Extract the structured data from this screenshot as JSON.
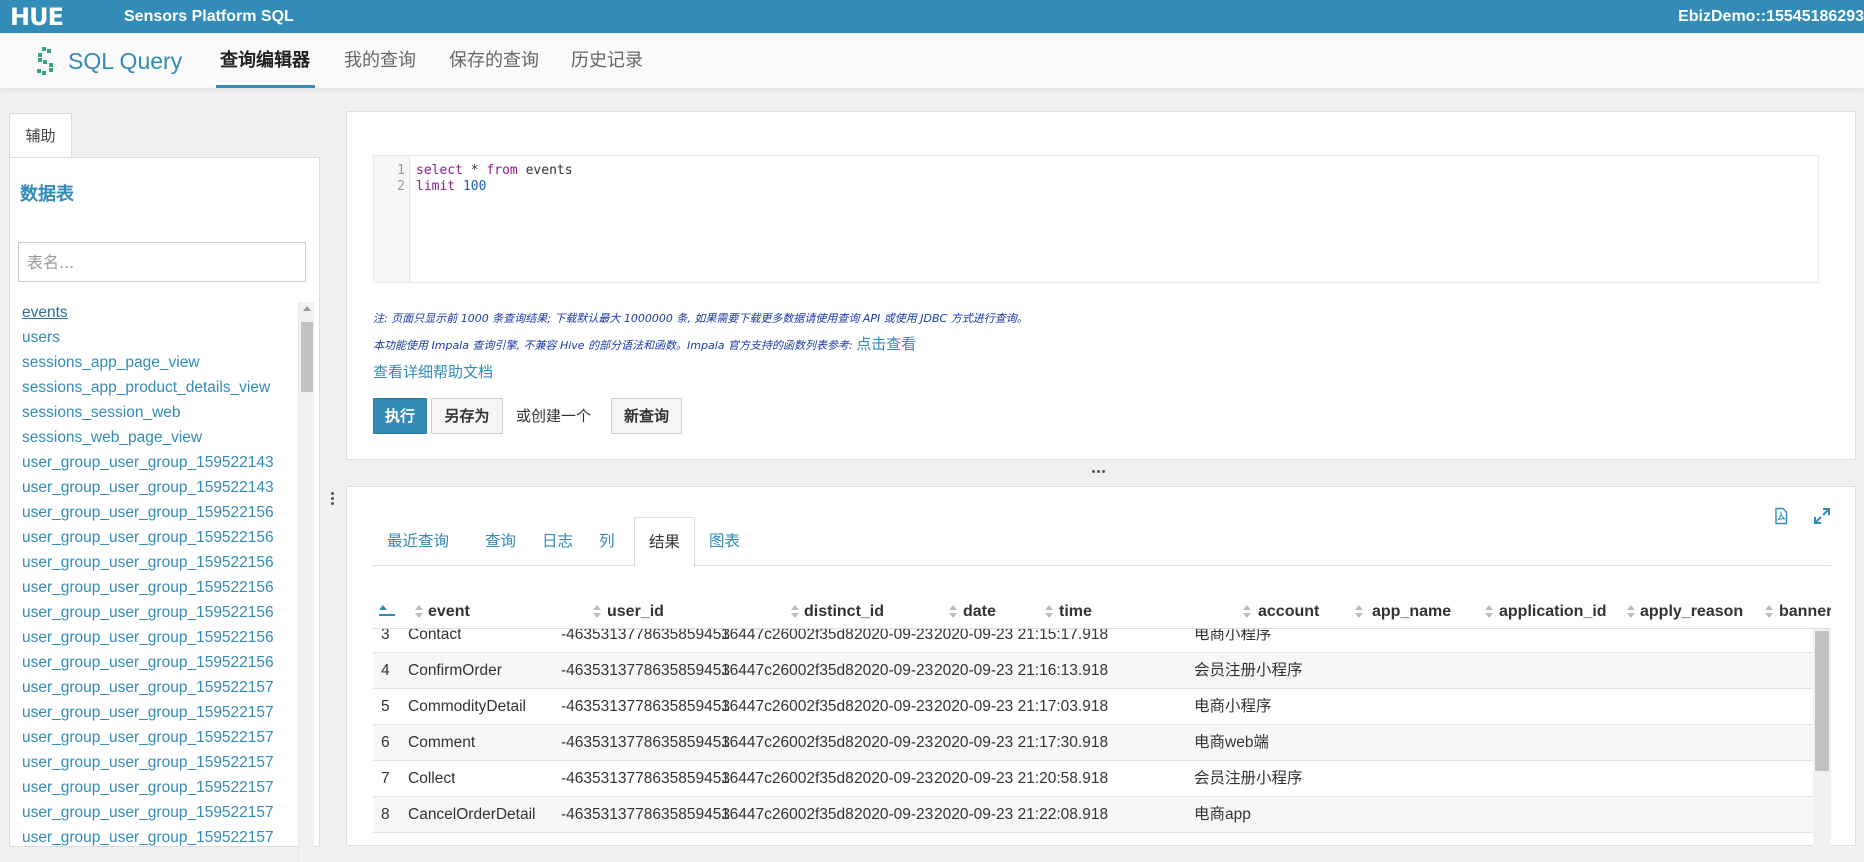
{
  "topbar": {
    "logo": "HUE",
    "platform_title": "Sensors Platform SQL",
    "user": "EbizDemo::15545186293"
  },
  "nav": {
    "app_title": "SQL Query",
    "tabs": [
      {
        "label": "查询编辑器",
        "active": true
      },
      {
        "label": "我的查询",
        "active": false
      },
      {
        "label": "保存的查询",
        "active": false
      },
      {
        "label": "历史记录",
        "active": false
      }
    ]
  },
  "assist": {
    "tab_label": "辅助",
    "heading": "数据表",
    "search_placeholder": "表名...",
    "tables": [
      "events",
      "users",
      "sessions_app_page_view",
      "sessions_app_product_details_view",
      "sessions_session_web",
      "sessions_web_page_view",
      "user_group_user_group_159522143",
      "user_group_user_group_159522143",
      "user_group_user_group_159522156",
      "user_group_user_group_159522156",
      "user_group_user_group_159522156",
      "user_group_user_group_159522156",
      "user_group_user_group_159522156",
      "user_group_user_group_159522156",
      "user_group_user_group_159522156",
      "user_group_user_group_159522157",
      "user_group_user_group_159522157",
      "user_group_user_group_159522157",
      "user_group_user_group_159522157",
      "user_group_user_group_159522157",
      "user_group_user_group_159522157",
      "user_group_user_group_159522157"
    ]
  },
  "editor": {
    "lines": [
      {
        "num": "1",
        "tokens": [
          [
            "kw",
            "select"
          ],
          [
            "txt",
            " * "
          ],
          [
            "kw",
            "from"
          ],
          [
            "txt",
            " events"
          ]
        ]
      },
      {
        "num": "2",
        "tokens": [
          [
            "kw",
            "limit"
          ],
          [
            "txt",
            " "
          ],
          [
            "num",
            "100"
          ]
        ]
      }
    ],
    "note1": "注: 页面只显示前 1000 条查询结果; 下载默认最大 1000000 条, 如果需要下载更多数据请使用查询 API 或使用 JDBC 方式进行查询。",
    "note2": "本功能使用 Impala 查询引擎, 不兼容 Hive 的部分语法和函数。Impala 官方支持的函数列表参考:",
    "note2_link": "点击查看",
    "help_link": "查看详细帮助文档",
    "execute_label": "执行",
    "save_as_label": "另存为",
    "or_create_label": "或创建一个",
    "new_query_label": "新查询"
  },
  "results": {
    "tabs": [
      {
        "label": "最近查询",
        "active": false
      },
      {
        "label": "查询",
        "active": false
      },
      {
        "label": "日志",
        "active": false
      },
      {
        "label": "列",
        "active": false
      },
      {
        "label": "结果",
        "active": true
      },
      {
        "label": "图表",
        "active": false
      }
    ],
    "icons": [
      "download-pdf-icon",
      "expand-icon"
    ],
    "columns": [
      "event",
      "user_id",
      "distinct_id",
      "date",
      "time",
      "account",
      "app_name",
      "application_id",
      "apply_reason",
      "banner"
    ],
    "rows": [
      [
        "3",
        "Contact",
        "-4635313778635859453",
        "16447c26002f35d8",
        "2020-09-23",
        "2020-09-23 21:15:17.918",
        "",
        "电商小程序"
      ],
      [
        "4",
        "ConfirmOrder",
        "-4635313778635859453",
        "16447c26002f35d8",
        "2020-09-23",
        "2020-09-23 21:16:13.918",
        "",
        "会员注册小程序"
      ],
      [
        "5",
        "CommodityDetail",
        "-4635313778635859453",
        "16447c26002f35d8",
        "2020-09-23",
        "2020-09-23 21:17:03.918",
        "",
        "电商小程序"
      ],
      [
        "6",
        "Comment",
        "-4635313778635859453",
        "16447c26002f35d8",
        "2020-09-23",
        "2020-09-23 21:17:30.918",
        "",
        "电商web端"
      ],
      [
        "7",
        "Collect",
        "-4635313778635859453",
        "16447c26002f35d8",
        "2020-09-23",
        "2020-09-23 21:20:58.918",
        "",
        "会员注册小程序"
      ],
      [
        "8",
        "CancelOrderDetail",
        "-4635313778635859453",
        "16447c26002f35d8",
        "2020-09-23",
        "2020-09-23 21:22:08.918",
        "",
        "电商app"
      ]
    ]
  },
  "colors": {
    "brand": "#338bb8",
    "note_text": "#1a3aa8"
  }
}
